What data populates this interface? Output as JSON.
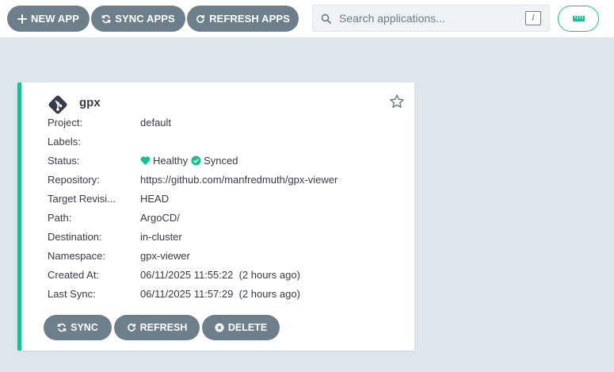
{
  "toolbar": {
    "new_app_label": "NEW APP",
    "sync_apps_label": "SYNC APPS",
    "refresh_apps_label": "REFRESH APPS",
    "search_placeholder": "Search applications...",
    "search_shortcut": "/",
    "view_toggle_icon": "ruler-icon"
  },
  "app": {
    "name": "gpx",
    "icon": "git-icon",
    "starred": false,
    "fields": [
      {
        "label": "Project:",
        "value": "default"
      },
      {
        "label": "Labels:",
        "value": ""
      },
      {
        "label": "Status:",
        "health": "Healthy",
        "sync": "Synced"
      },
      {
        "label": "Repository:",
        "value": "https://github.com/manfredmuth/gpx-viewer"
      },
      {
        "label": "Target Revisi...",
        "value": "HEAD"
      },
      {
        "label": "Path:",
        "value": "ArgoCD/"
      },
      {
        "label": "Destination:",
        "value": "in-cluster"
      },
      {
        "label": "Namespace:",
        "value": "gpx-viewer"
      },
      {
        "label": "Created At:",
        "value": "06/11/2025 11:55:22  (2 hours ago)"
      },
      {
        "label": "Last Sync:",
        "value": "06/11/2025 11:57:29  (2 hours ago)"
      }
    ],
    "actions": {
      "sync_label": "SYNC",
      "refresh_label": "REFRESH",
      "delete_label": "DELETE"
    }
  },
  "colors": {
    "accent": "#18be94",
    "button": "#6d7f8b",
    "background": "#dee6eb",
    "text": "#363c4a"
  }
}
